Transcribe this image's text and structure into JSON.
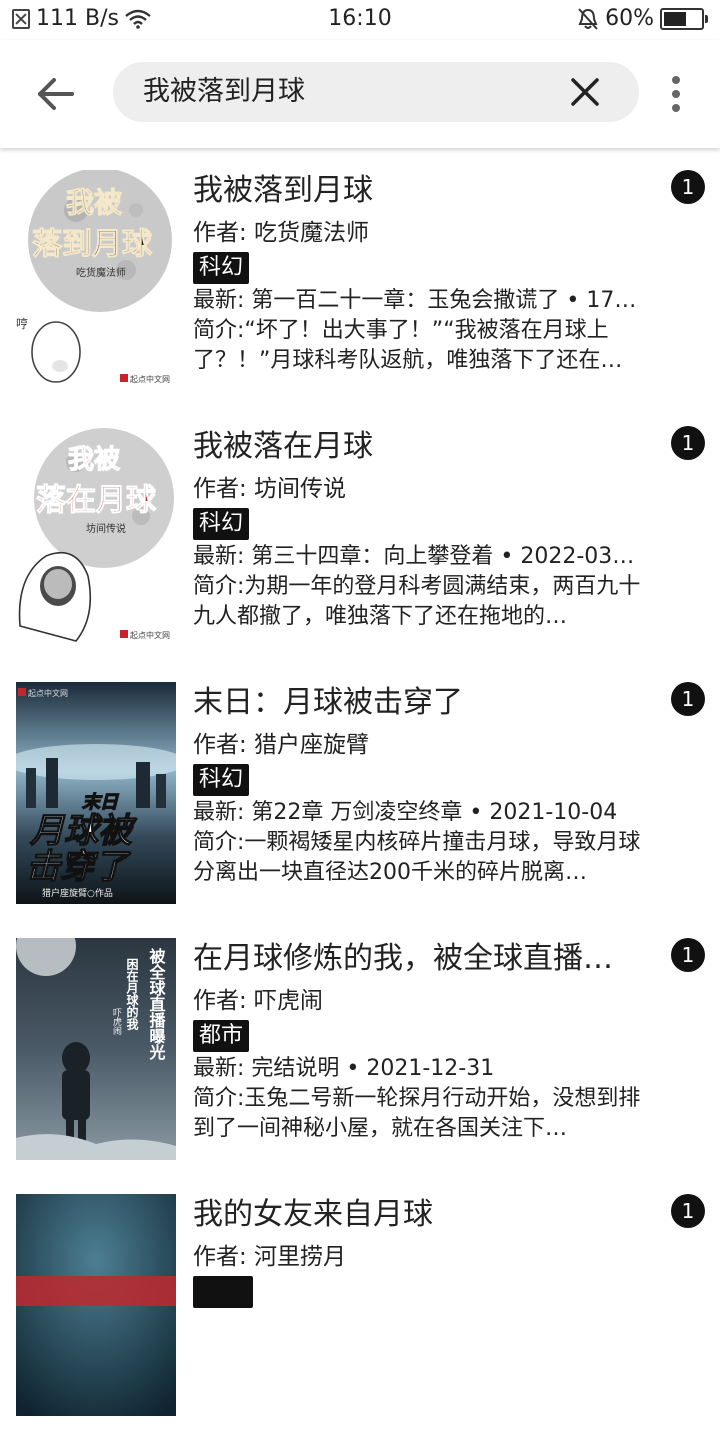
{
  "status_bar": {
    "net_speed": "111 B/s",
    "time": "16:10",
    "battery": "60%",
    "battery_level": 0.6
  },
  "search": {
    "query": "我被落到月球"
  },
  "results": [
    {
      "title": "我被落到月球",
      "author": "作者: 吃货魔法师",
      "tag": "科幻",
      "latest": "最新: 第一百二十一章：玉兔会撒谎了 • 17…",
      "desc": "简介:“坏了！出大事了！”“我被落在月球上了？！”月球科考队返航，唯独落下了还在…",
      "badge": "1",
      "cover_title_1": "我被",
      "cover_title_2": "落到月球",
      "cover_author": "吃货魔法师",
      "cover_publisher": "起点中文网"
    },
    {
      "title": "我被落在月球",
      "author": "作者: 坊间传说",
      "tag": "科幻",
      "latest": "最新: 第三十四章：向上攀登着 • 2022-03…",
      "desc": "简介:为期一年的登月科考圆满结束，两百九十九人都撤了，唯独落下了还在拖地的…",
      "badge": "1",
      "cover_title_1": "我被",
      "cover_title_2": "落在月球",
      "cover_author": "坊间传说",
      "cover_publisher": "起点中文网"
    },
    {
      "title": "末日：月球被击穿了",
      "author": "作者: 猎户座旋臂",
      "tag": "科幻",
      "latest": "最新: 第22章 万剑凌空终章 • 2021-10-04",
      "desc": "简介:一颗褐矮星内核碎片撞击月球，导致月球分离出一块直径达200千米的碎片脱离…",
      "badge": "1",
      "cover_title_1": "末日",
      "cover_title_2": "月球被",
      "cover_title_3": "击穿了",
      "cover_author": "猎户座旋臂○作品",
      "cover_publisher": "起点中文网"
    },
    {
      "title": "在月球修炼的我，被全球直播…",
      "author": "作者: 吓虎闹",
      "tag": "都市",
      "latest": "最新: 完结说明 • 2021-12-31",
      "desc": "简介:玉兔二号新一轮探月行动开始，没想到排到了一间神秘小屋，就在各国关注下…",
      "badge": "1",
      "cover_title_1": "被全球直播曝光",
      "cover_title_2": "困在月球的我",
      "cover_author": "吓虎闹"
    },
    {
      "title": "我的女友来自月球",
      "author": "作者: 河里捞月",
      "tag": "",
      "latest": "",
      "desc": "",
      "badge": "1"
    }
  ]
}
